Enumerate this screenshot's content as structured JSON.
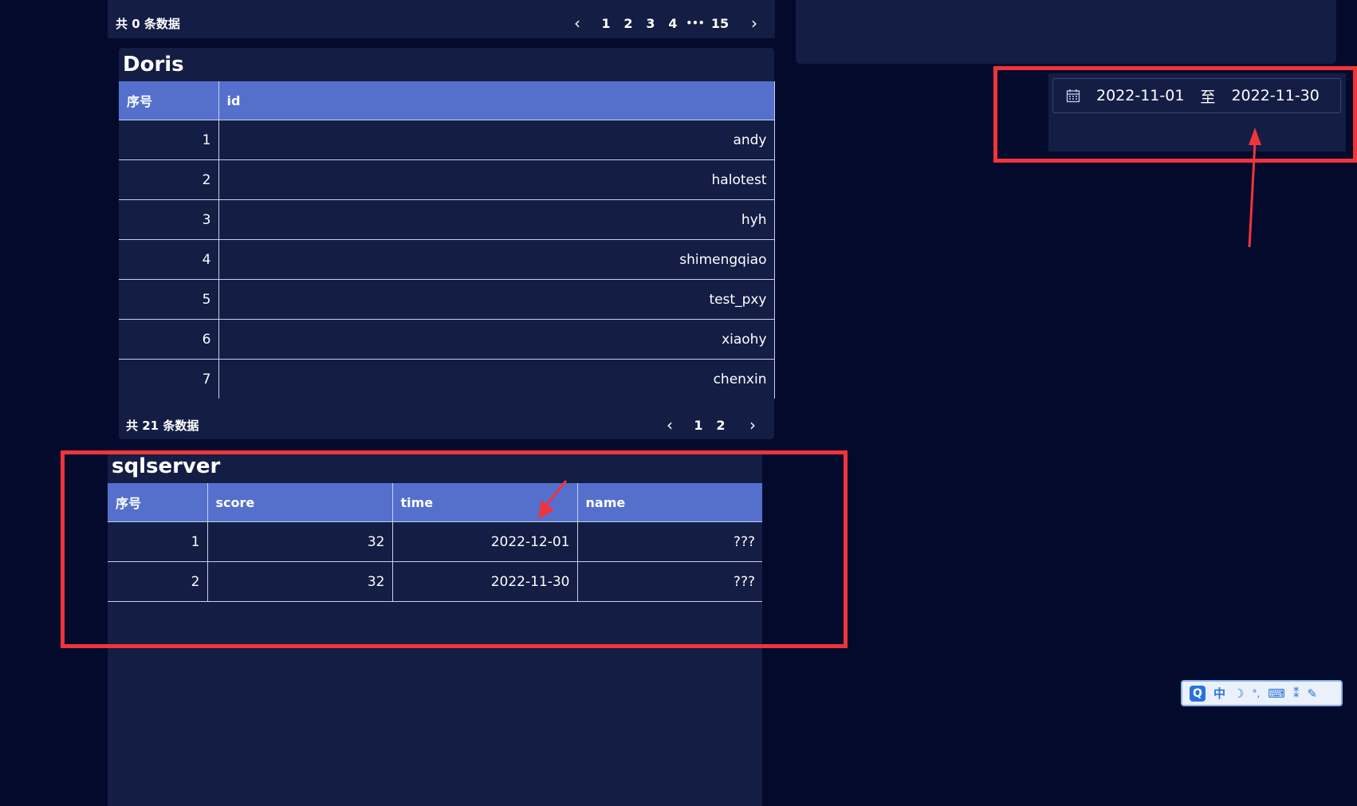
{
  "top_pager": {
    "total": "共 0 条数据",
    "prev": "‹",
    "pages": [
      "1",
      "2",
      "3",
      "4",
      "•••",
      "15"
    ],
    "next": "›"
  },
  "doris": {
    "title": "Doris",
    "columns": [
      "序号",
      "id"
    ],
    "rows": [
      [
        "1",
        "andy"
      ],
      [
        "2",
        "halotest"
      ],
      [
        "3",
        "hyh"
      ],
      [
        "4",
        "shimengqiao"
      ],
      [
        "5",
        "test_pxy"
      ],
      [
        "6",
        "xiaohy"
      ],
      [
        "7",
        "chenxin"
      ]
    ],
    "total": "共 21 条数据",
    "prev": "‹",
    "pages": [
      "1",
      "2"
    ],
    "next": "›"
  },
  "sqlserver": {
    "title": "sqlserver",
    "columns": [
      "序号",
      "score",
      "time",
      "name"
    ],
    "rows": [
      [
        "1",
        "32",
        "2022-12-01",
        "???"
      ],
      [
        "2",
        "32",
        "2022-11-30",
        "???"
      ]
    ]
  },
  "date_range": {
    "start": "2022-11-01",
    "separator": "至",
    "end": "2022-11-30",
    "icon": "calendar-icon"
  },
  "ime_toolbar": {
    "logo": "Q",
    "lang": "中",
    "moon": "☽",
    "punct": "°,",
    "keyboard": "⌨",
    "tools": "⁑",
    "wrench": "✎"
  },
  "colors": {
    "background": "#030a2b",
    "panel": "#141d44",
    "table_header": "#5570cc",
    "annotation": "#f0343c"
  }
}
